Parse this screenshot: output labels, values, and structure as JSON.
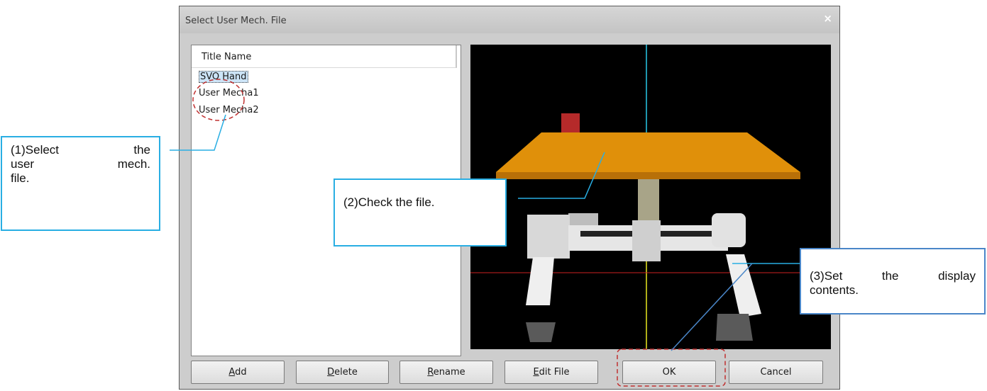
{
  "dialog": {
    "title": "Select User Mech. File",
    "close_glyph": "×",
    "list": {
      "header": "Title Name",
      "items": [
        "SVO Hand",
        "User Mecha1",
        "User Mecha2"
      ],
      "selected_index": 0
    },
    "buttons": {
      "add": {
        "pre": "",
        "key": "A",
        "post": "dd"
      },
      "delete": {
        "pre": "",
        "key": "D",
        "post": "elete"
      },
      "rename": {
        "pre": "",
        "key": "R",
        "post": "ename"
      },
      "edit_file": {
        "pre": "",
        "key": "E",
        "post": "dit File"
      },
      "ok": "OK",
      "cancel": "Cancel"
    },
    "preview": {
      "background": "#000000",
      "table_color": "#e0900a",
      "axis_colors": [
        "#29c8e8",
        "#cc2222",
        "#e8e820"
      ]
    }
  },
  "callouts": {
    "select": {
      "line1": "(1)Select the",
      "line2": "user mech.",
      "line3": "file."
    },
    "check": "(2)Check the file.",
    "display": {
      "line1": "(3)Set the display",
      "line2": "contents."
    }
  },
  "colors": {
    "callout_border": "#29aee3",
    "highlight_dash": "#c03030",
    "pointer_line": "#4a86c8"
  }
}
